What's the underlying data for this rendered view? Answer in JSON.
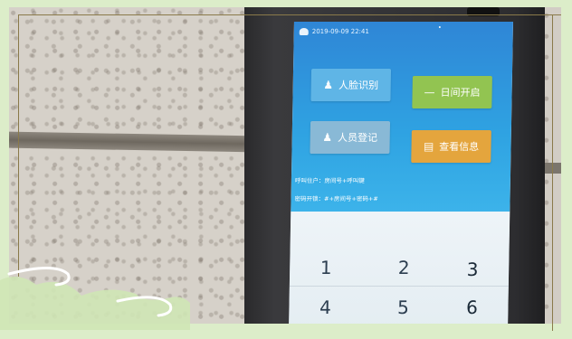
{
  "device": {
    "status_bar": {
      "datetime": "2019-09-09 22:41"
    },
    "buttons": [
      {
        "label": "人脸识别",
        "icon": "person-icon",
        "color": "#5fb5e6"
      },
      {
        "label": "日间开启",
        "icon": "minus-icon",
        "color": "#92c451"
      },
      {
        "label": "人员登记",
        "icon": "users-icon",
        "color": "#89b9d6"
      },
      {
        "label": "查看信息",
        "icon": "document-icon",
        "color": "#e4a53d"
      }
    ],
    "info_lines": [
      "呼叫住户：房间号+呼叫键",
      "密码开锁：#+房间号+密码+#"
    ],
    "keypad": {
      "keys": [
        "1",
        "2",
        "3",
        "4",
        "5",
        "6"
      ]
    }
  },
  "colors": {
    "screen_blue": "#2fa3e2",
    "frame_green": "#dcedc9"
  }
}
